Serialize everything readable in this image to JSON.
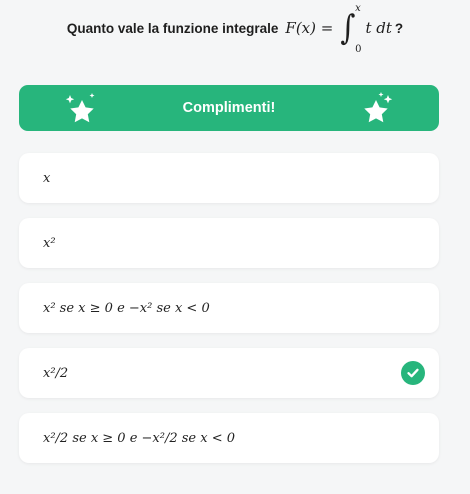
{
  "question": {
    "prefix": "Quanto vale la funzione integrale",
    "lhs": "F(x) =",
    "upper_limit": "x",
    "lower_limit": "0",
    "integrand": "t dt",
    "suffix": "?"
  },
  "banner": {
    "label": "Complimenti!",
    "color": "#27b57c",
    "icons": [
      "sparkle-star-icon",
      "sparkle-star-icon"
    ]
  },
  "options": [
    {
      "text": "x",
      "selected": false
    },
    {
      "text": "x²",
      "selected": false
    },
    {
      "text": "x² se x ≥ 0 e −x² se x < 0",
      "selected": false
    },
    {
      "text": "x²/2",
      "selected": true
    },
    {
      "text": "x²/2 se x ≥ 0 e −x²/2 se x < 0",
      "selected": false
    }
  ],
  "correct_icon": "check-circle-icon"
}
